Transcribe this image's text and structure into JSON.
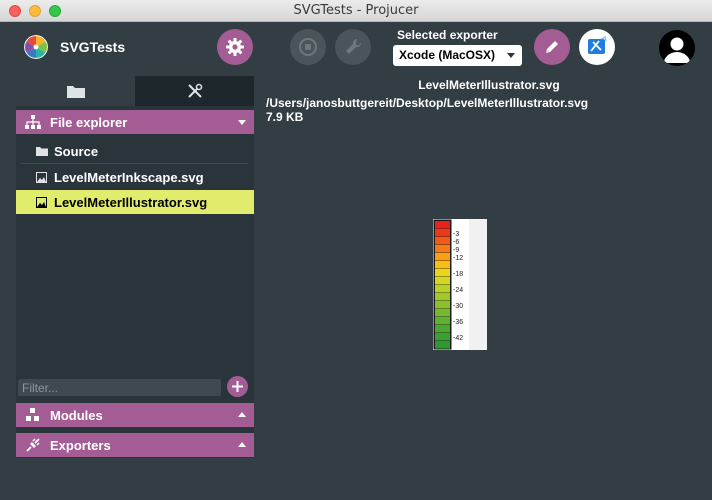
{
  "window": {
    "title": "SVGTests - Projucer"
  },
  "header": {
    "project_name": "SVGTests",
    "exporter_label": "Selected exporter",
    "exporter_value": "Xcode (MacOSX)"
  },
  "sidebar": {
    "file_explorer_label": "File explorer",
    "files": [
      {
        "label": "Source",
        "icon": "folder-icon"
      },
      {
        "label": "LevelMeterInkscape.svg",
        "icon": "image-icon"
      },
      {
        "label": "LevelMeterIllustrator.svg",
        "icon": "image-icon",
        "selected": true
      }
    ],
    "filter_placeholder": "Filter...",
    "modules_label": "Modules",
    "exporters_label": "Exporters"
  },
  "preview": {
    "filename": "LevelMeterIllustrator.svg",
    "path": "/Users/janosbuttgereit/Desktop/LevelMeterIllustrator.svg",
    "size": "7.9 KB",
    "meter_labels": [
      "3",
      "6",
      "9",
      "12",
      "18",
      "24",
      "30",
      "36",
      "42"
    ]
  },
  "colors": {
    "accent": "#a45c94",
    "selection": "#e2ec6c",
    "background": "#323e44"
  }
}
